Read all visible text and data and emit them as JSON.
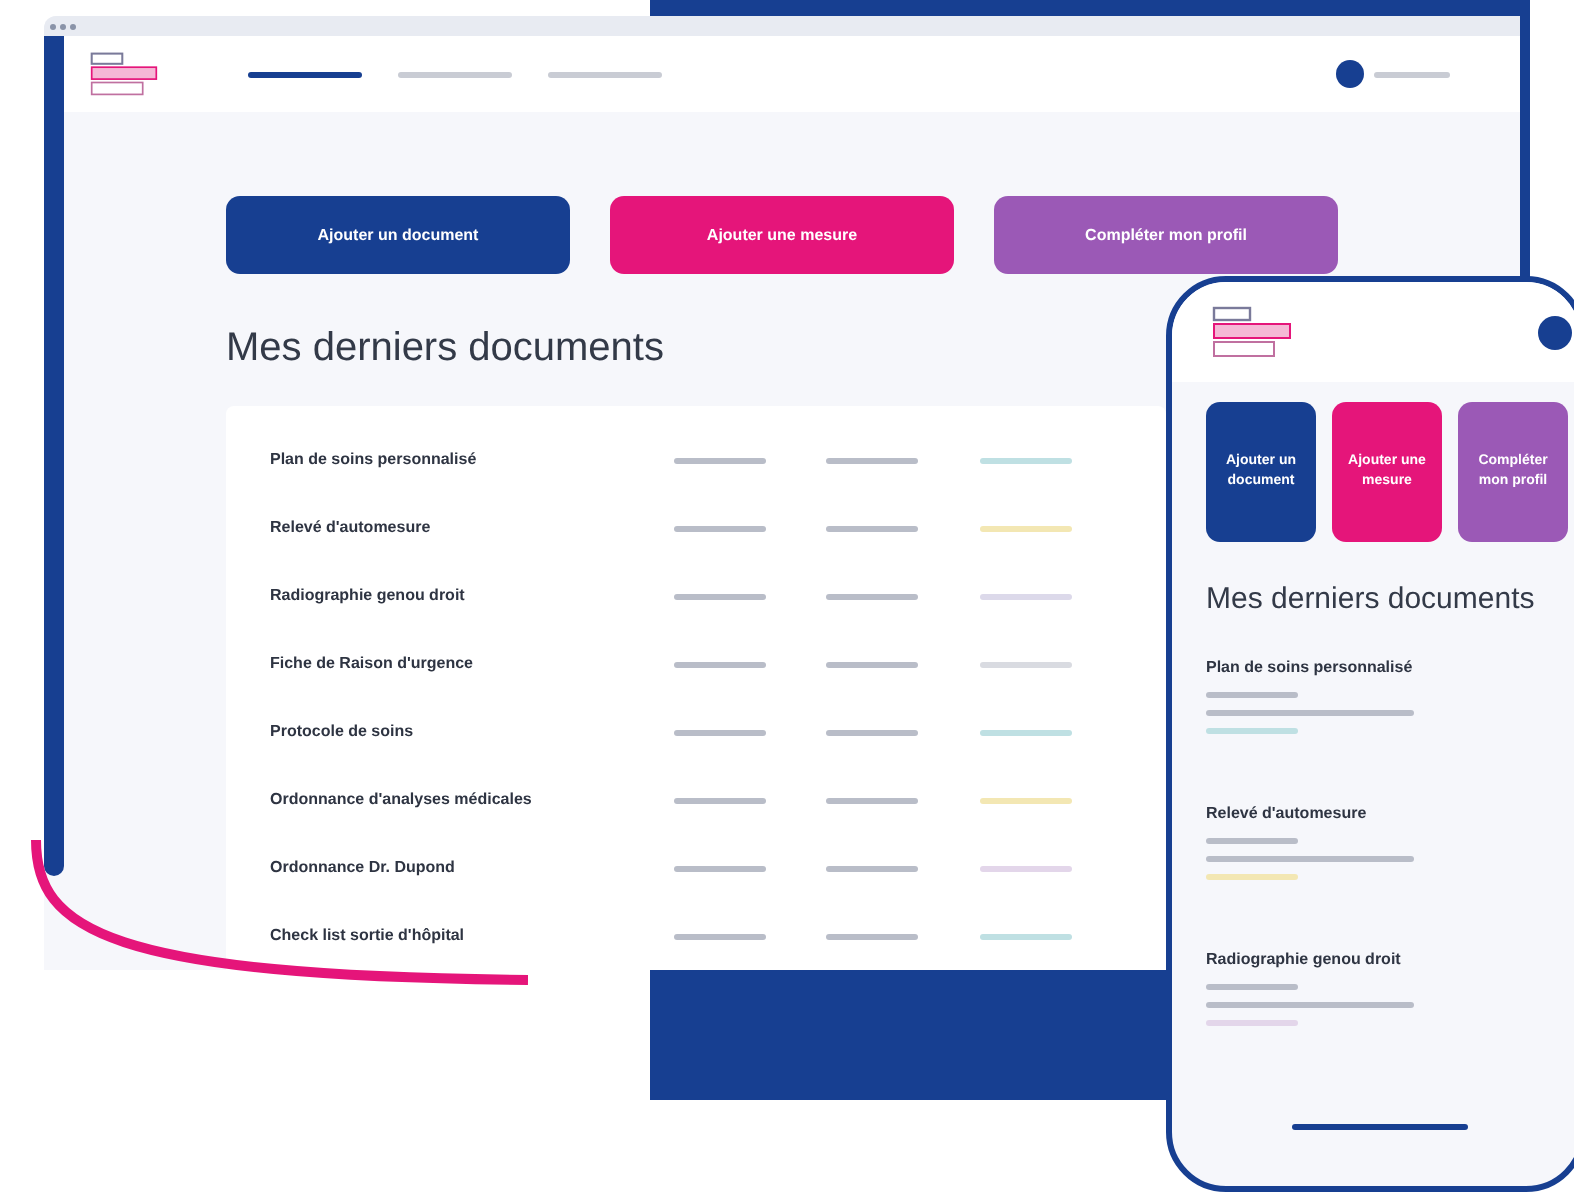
{
  "desktop": {
    "nav": [
      {
        "selected": true
      },
      {
        "selected": false
      },
      {
        "selected": false
      }
    ],
    "actions": [
      {
        "label": "Ajouter un document",
        "color": "#173f91"
      },
      {
        "label": "Ajouter une mesure",
        "color": "#e5157a"
      },
      {
        "label": "Compléter mon profil",
        "color": "#9b59b6"
      }
    ],
    "heading": "Mes derniers documents",
    "documents": [
      {
        "title": "Plan de soins personnalisé",
        "color": "#bfe0e3"
      },
      {
        "title": "Relevé d'automesure",
        "color": "#f3e7b3"
      },
      {
        "title": "Radiographie genou droit",
        "color": "#dcd9ea"
      },
      {
        "title": "Fiche de Raison d'urgence",
        "color": "#d9dbe1"
      },
      {
        "title": "Protocole de soins",
        "color": "#bfe0e3"
      },
      {
        "title": "Ordonnance d'analyses médicales",
        "color": "#f3e7b3"
      },
      {
        "title": "Ordonnance Dr. Dupond",
        "color": "#e3d6ea"
      },
      {
        "title": "Check list sortie d'hôpital",
        "color": "#bfe0e3"
      }
    ]
  },
  "phone": {
    "actions": [
      {
        "label": "Ajouter un document",
        "color": "#173f91"
      },
      {
        "label": "Ajouter une mesure",
        "color": "#e5157a"
      },
      {
        "label": "Compléter mon profil",
        "color": "#9b59b6"
      }
    ],
    "heading": "Mes derniers documents",
    "documents": [
      {
        "title": "Plan de soins personnalisé",
        "color": "#bfe0e3"
      },
      {
        "title": "Relevé d'automesure",
        "color": "#f3e7b3"
      },
      {
        "title": "Radiographie genou droit",
        "color": "#e3d6ea"
      }
    ]
  }
}
